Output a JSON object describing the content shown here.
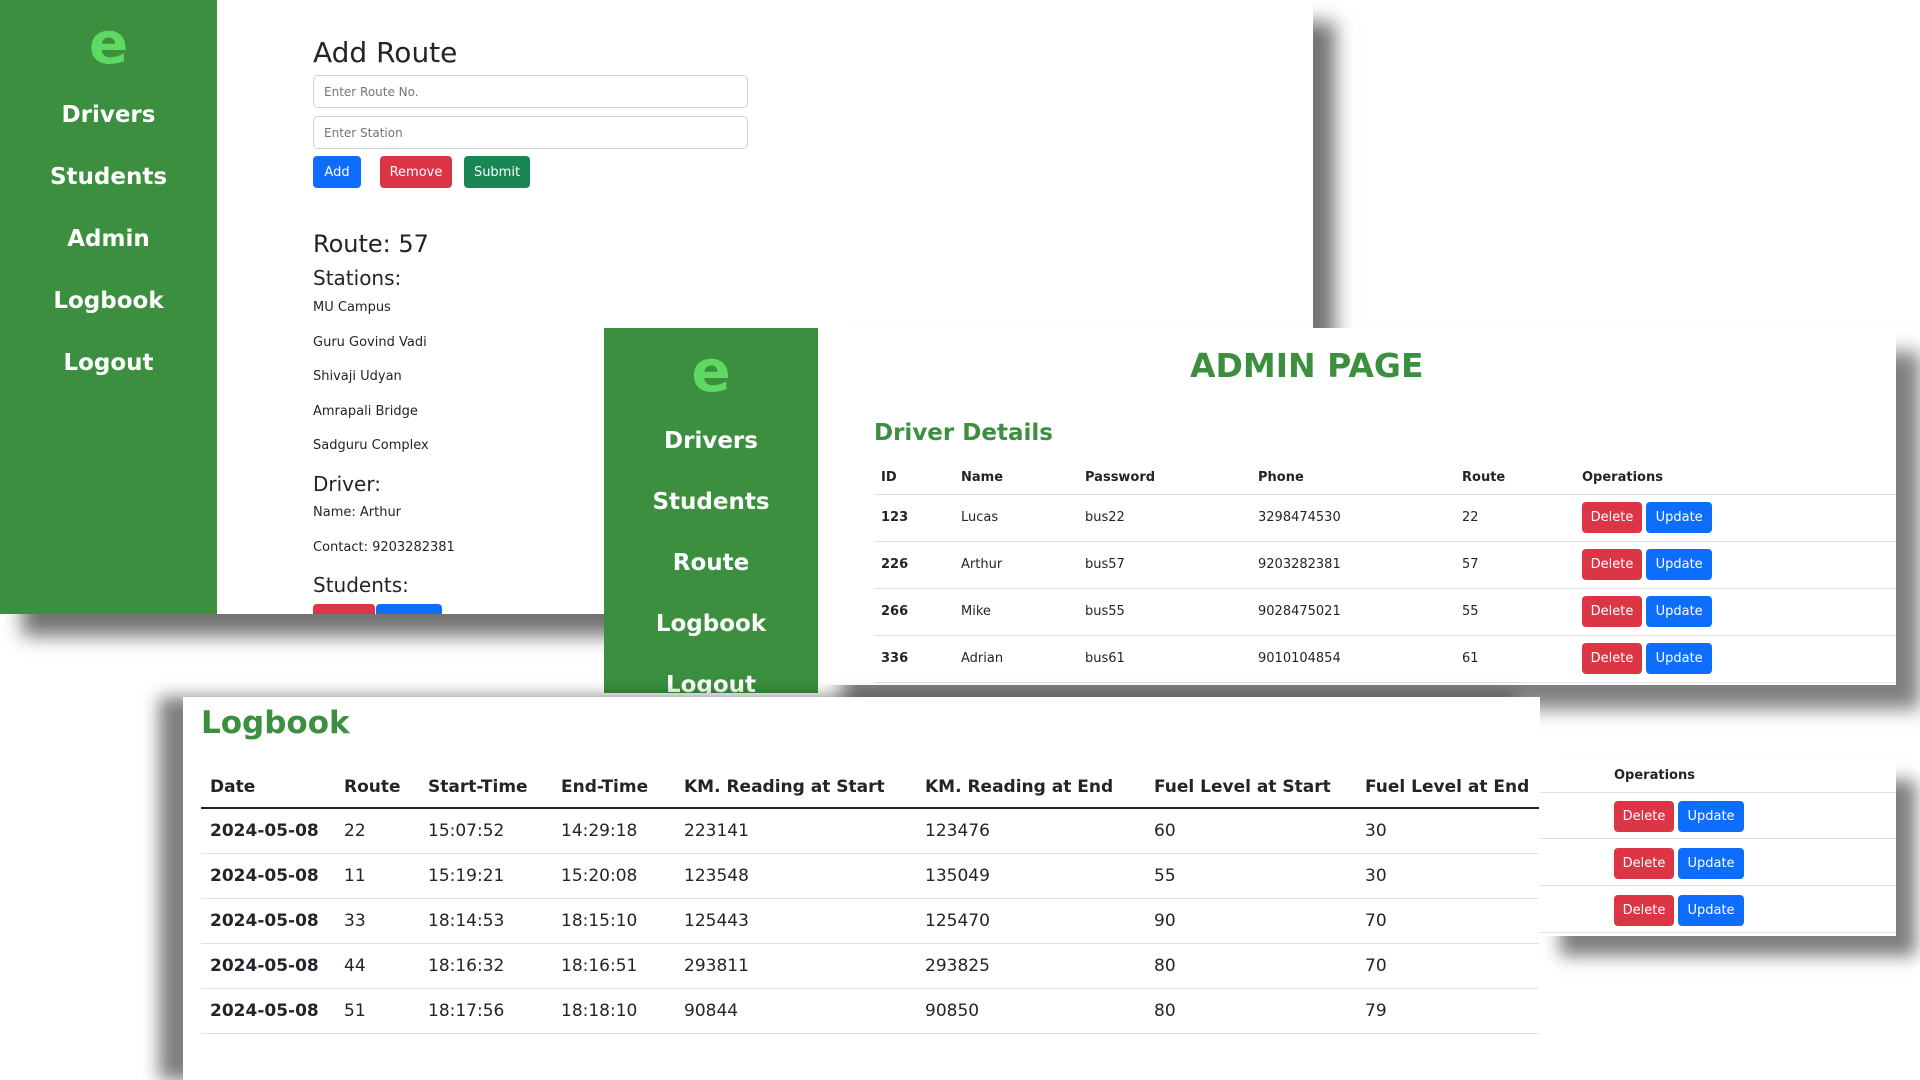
{
  "nav_a": {
    "logo": "e",
    "items": [
      "Drivers",
      "Students",
      "Admin",
      "Logbook",
      "Logout"
    ]
  },
  "add_route": {
    "title": "Add Route",
    "route_placeholder": "Enter Route No.",
    "station_placeholder": "Enter Station",
    "add_label": "Add",
    "remove_label": "Remove",
    "submit_label": "Submit",
    "route_heading": "Route: 57",
    "stations_heading": "Stations:",
    "stations": [
      "MU Campus",
      "Guru Govind Vadi",
      "Shivaji Udyan",
      "Amrapali Bridge",
      "Sadguru Complex"
    ],
    "driver_heading": "Driver:",
    "driver_name": "Name: Arthur",
    "driver_contact": "Contact: 9203282381",
    "students_heading": "Students:"
  },
  "nav_b": {
    "logo": "e",
    "items": [
      "Drivers",
      "Students",
      "Route",
      "Logbook",
      "Logout"
    ]
  },
  "admin": {
    "title": "ADMIN PAGE",
    "section_title": "Driver Details",
    "columns": [
      "ID",
      "Name",
      "Password",
      "Phone",
      "Route",
      "Operations"
    ],
    "rows": [
      [
        "123",
        "Lucas",
        "bus22",
        "3298474530",
        "22"
      ],
      [
        "226",
        "Arthur",
        "bus57",
        "9203282381",
        "57"
      ],
      [
        "266",
        "Mike",
        "bus55",
        "9028475021",
        "55"
      ],
      [
        "336",
        "Adrian",
        "bus61",
        "9010104854",
        "61"
      ]
    ],
    "delete_label": "Delete",
    "update_label": "Update"
  },
  "students_ops": {
    "header": "Operations",
    "delete_label": "Delete",
    "update_label": "Update",
    "row_count": 3
  },
  "logbook": {
    "title": "Logbook",
    "columns": [
      "Date",
      "Route",
      "Start-Time",
      "End-Time",
      "KM. Reading at Start",
      "KM. Reading at End",
      "Fuel Level at Start",
      "Fuel Level at End"
    ],
    "rows": [
      [
        "2024-05-08",
        "22",
        "15:07:52",
        "14:29:18",
        "223141",
        "123476",
        "60",
        "30"
      ],
      [
        "2024-05-08",
        "11",
        "15:19:21",
        "15:20:08",
        "123548",
        "135049",
        "55",
        "30"
      ],
      [
        "2024-05-08",
        "33",
        "18:14:53",
        "18:15:10",
        "125443",
        "125470",
        "90",
        "70"
      ],
      [
        "2024-05-08",
        "44",
        "18:16:32",
        "18:16:51",
        "293811",
        "293825",
        "80",
        "70"
      ],
      [
        "2024-05-08",
        "51",
        "18:17:56",
        "18:18:10",
        "90844",
        "90850",
        "80",
        "79"
      ]
    ]
  },
  "colors": {
    "sidebar": "#3b8f3e",
    "logo": "#5fd864",
    "primary": "#0d6efd",
    "danger": "#dc3545",
    "success": "#198754"
  }
}
